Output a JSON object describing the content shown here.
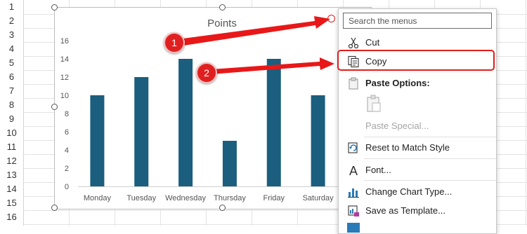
{
  "sheet": {
    "row_numbers": [
      "1",
      "2",
      "3",
      "4",
      "5",
      "6",
      "7",
      "8",
      "9",
      "10",
      "11",
      "12",
      "13",
      "14",
      "15",
      "16"
    ]
  },
  "chart": {
    "title": "Points",
    "y_ticks": [
      "0",
      "2",
      "4",
      "6",
      "8",
      "10",
      "12",
      "14",
      "16"
    ],
    "bar_color": "#1b5e7e"
  },
  "chart_data": {
    "type": "bar",
    "title": "Points",
    "categories": [
      "Monday",
      "Tuesday",
      "Wednesday",
      "Thursday",
      "Friday",
      "Saturday"
    ],
    "values": [
      10,
      12,
      14,
      5,
      14,
      10
    ],
    "xlabel": "",
    "ylabel": "",
    "ylim": [
      0,
      16
    ],
    "grid": false
  },
  "context_menu": {
    "search_placeholder": "Search the menus",
    "items": {
      "cut": "Cut",
      "copy": "Copy",
      "paste_options": "Paste Options:",
      "paste_special": "Paste Special...",
      "reset": "Reset to Match Style",
      "font": "Font...",
      "change_chart_type": "Change Chart Type...",
      "save_template": "Save as Template..."
    }
  },
  "annotations": {
    "callout_1": "1",
    "callout_2": "2",
    "accent": "#e11d1d"
  }
}
